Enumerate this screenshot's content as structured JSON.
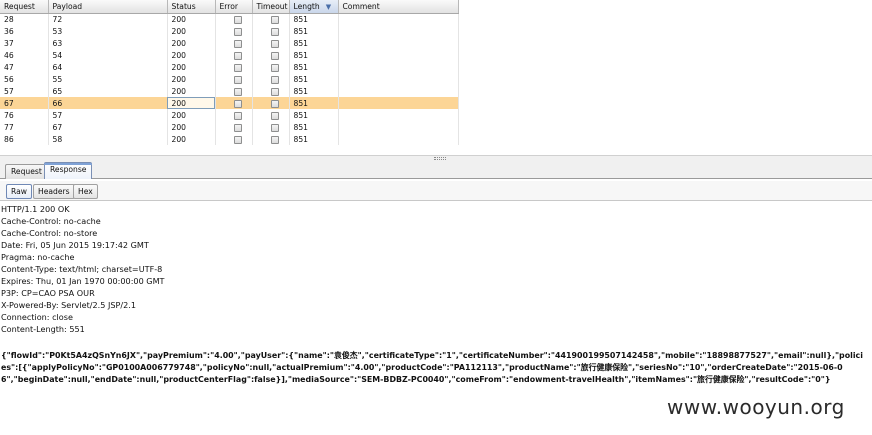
{
  "table": {
    "columns": [
      {
        "key": "request",
        "label": "Request"
      },
      {
        "key": "payload",
        "label": "Payload"
      },
      {
        "key": "status",
        "label": "Status"
      },
      {
        "key": "error",
        "label": "Error"
      },
      {
        "key": "timeout",
        "label": "Timeout"
      },
      {
        "key": "length",
        "label": "Length"
      },
      {
        "key": "comment",
        "label": "Comment"
      }
    ],
    "sort_indicator": "▼",
    "rows": [
      {
        "request": "28",
        "payload": "72",
        "status": "200",
        "length": "851",
        "selected": false
      },
      {
        "request": "36",
        "payload": "53",
        "status": "200",
        "length": "851",
        "selected": false
      },
      {
        "request": "37",
        "payload": "63",
        "status": "200",
        "length": "851",
        "selected": false
      },
      {
        "request": "46",
        "payload": "54",
        "status": "200",
        "length": "851",
        "selected": false
      },
      {
        "request": "47",
        "payload": "64",
        "status": "200",
        "length": "851",
        "selected": false
      },
      {
        "request": "56",
        "payload": "55",
        "status": "200",
        "length": "851",
        "selected": false
      },
      {
        "request": "57",
        "payload": "65",
        "status": "200",
        "length": "851",
        "selected": false
      },
      {
        "request": "67",
        "payload": "66",
        "status": "200",
        "length": "851",
        "selected": true
      },
      {
        "request": "76",
        "payload": "57",
        "status": "200",
        "length": "851",
        "selected": false
      },
      {
        "request": "77",
        "payload": "67",
        "status": "200",
        "length": "851",
        "selected": false
      },
      {
        "request": "86",
        "payload": "58",
        "status": "200",
        "length": "851",
        "selected": false
      }
    ]
  },
  "tabs": {
    "request": "Request",
    "response": "Response"
  },
  "subtabs": {
    "raw": "Raw",
    "headers": "Headers",
    "hex": "Hex"
  },
  "response": {
    "lines": [
      "HTTP/1.1 200 OK",
      "Cache-Control: no-cache",
      "Cache-Control: no-store",
      "Date: Fri, 05 Jun 2015 19:17:42 GMT",
      "Pragma: no-cache",
      "Content-Type: text/html; charset=UTF-8",
      "Expires: Thu, 01 Jan 1970 00:00:00 GMT",
      "P3P: CP=CAO PSA OUR",
      "X-Powered-By: Servlet/2.5 JSP/2.1",
      "Connection: close",
      "Content-Length: 551"
    ],
    "body": "{\"flowId\":\"P0Kt5A4zQSnYn6JX\",\"payPremium\":\"4.00\",\"payUser\":{\"name\":\"袁俊杰\",\"certificateType\":\"1\",\"certificateNumber\":\"441900199507142458\",\"mobile\":\"18898877527\",\"email\":null},\"policies\":[{\"applyPolicyNo\":\"GP0100A006779748\",\"policyNo\":null,\"actualPremium\":\"4.00\",\"productCode\":\"PA112113\",\"productName\":\"旅行健康保险\",\"seriesNo\":\"10\",\"orderCreateDate\":\"2015-06-06\",\"beginDate\":null,\"endDate\":null,\"productCenterFlag\":false}],\"mediaSource\":\"SEM-BDBZ-PC0040\",\"comeFrom\":\"endowment-travelHealth\",\"itemNames\":\"旅行健康保险\",\"resultCode\":\"0\"}"
  },
  "watermark": "www.wooyun.org"
}
